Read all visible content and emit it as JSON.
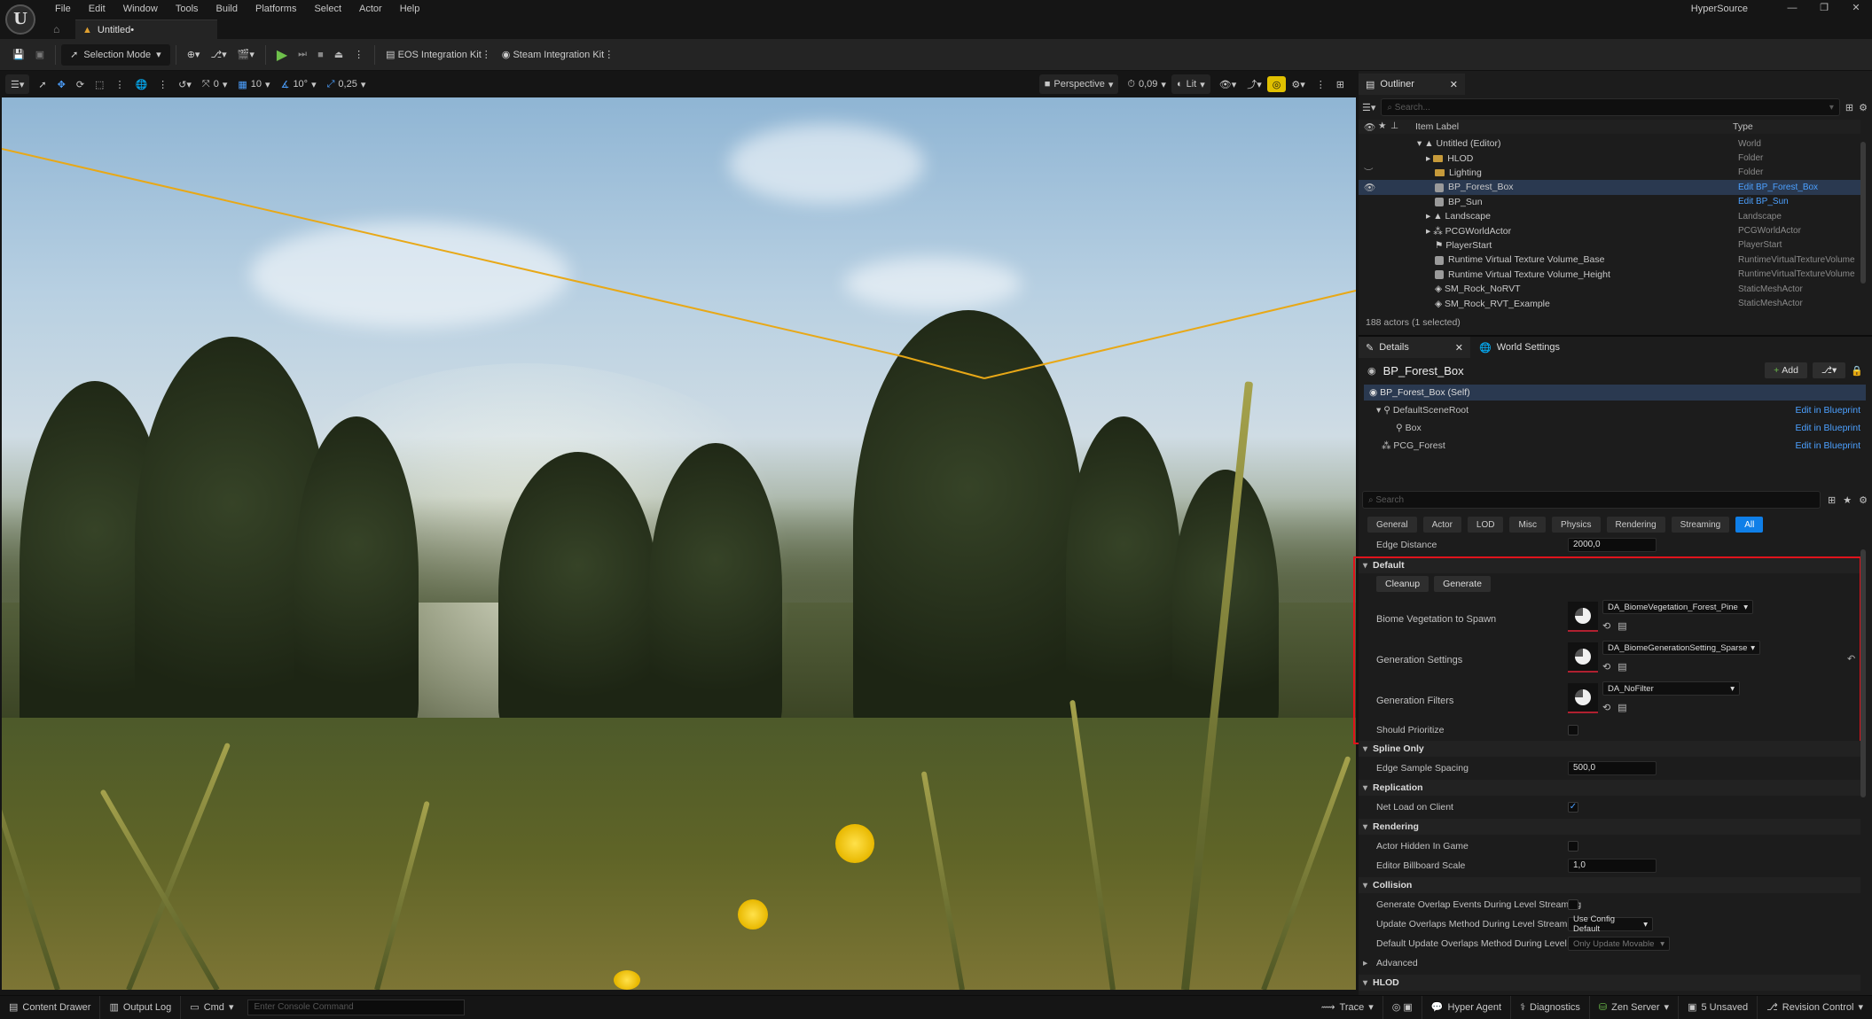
{
  "app": {
    "title": "HyperSource",
    "doc_tab": "Untitled•",
    "logo": "U"
  },
  "menu": [
    "File",
    "Edit",
    "Window",
    "Tools",
    "Build",
    "Platforms",
    "Select",
    "Actor",
    "Help"
  ],
  "toolbar": {
    "mode": "Selection Mode",
    "eos": "EOS Integration Kit",
    "steam": "Steam Integration Kit"
  },
  "viewport_toolbar": {
    "snap_rotate": "0",
    "grid": "10",
    "angle": "10°",
    "scale": "0,25",
    "view": "Perspective",
    "fov": "0,09",
    "lit": "Lit"
  },
  "outliner": {
    "tab": "Outliner",
    "search_placeholder": "Search...",
    "col_label": "Item Label",
    "col_type": "Type",
    "rows": [
      {
        "label": "Untitled (Editor)",
        "type": "World"
      },
      {
        "label": "HLOD",
        "type": "Folder"
      },
      {
        "label": "Lighting",
        "type": "Folder"
      },
      {
        "label": "BP_Forest_Box",
        "type": "Edit BP_Forest_Box"
      },
      {
        "label": "BP_Sun",
        "type": "Edit BP_Sun"
      },
      {
        "label": "Landscape",
        "type": "Landscape"
      },
      {
        "label": "PCGWorldActor",
        "type": "PCGWorldActor"
      },
      {
        "label": "PlayerStart",
        "type": "PlayerStart"
      },
      {
        "label": "Runtime Virtual Texture Volume_Base",
        "type": "RuntimeVirtualTextureVolume"
      },
      {
        "label": "Runtime Virtual Texture Volume_Height",
        "type": "RuntimeVirtualTextureVolume"
      },
      {
        "label": "SM_Rock_NoRVT",
        "type": "StaticMeshActor"
      },
      {
        "label": "SM_Rock_RVT_Example",
        "type": "StaticMeshActor"
      }
    ],
    "count": "188 actors (1 selected)"
  },
  "details": {
    "tab": "Details",
    "tab2": "World Settings",
    "actor_name": "BP_Forest_Box",
    "add_label": "Add",
    "components": [
      {
        "label": "BP_Forest_Box (Self)",
        "action": ""
      },
      {
        "label": "DefaultSceneRoot",
        "action": "Edit in Blueprint"
      },
      {
        "label": "Box",
        "action": "Edit in Blueprint"
      },
      {
        "label": "PCG_Forest",
        "action": "Edit in Blueprint"
      }
    ],
    "search_placeholder": "Search",
    "filters": [
      "General",
      "Actor",
      "LOD",
      "Misc",
      "Physics",
      "Rendering",
      "Streaming",
      "All"
    ],
    "edge_distance_label": "Edge Distance",
    "edge_distance": "2000,0",
    "section_default": "Default",
    "cleanup": "Cleanup",
    "generate": "Generate",
    "biome_label": "Biome Vegetation to Spawn",
    "biome_value": "DA_BiomeVegetation_Forest_Pine",
    "gen_settings_label": "Generation Settings",
    "gen_settings_value": "DA_BiomeGenerationSetting_Sparse",
    "gen_filters_label": "Generation Filters",
    "gen_filters_value": "DA_NoFilter",
    "should_prioritize": "Should Prioritize",
    "section_spline": "Spline Only",
    "edge_sample_label": "Edge Sample Spacing",
    "edge_sample": "500,0",
    "section_replication": "Replication",
    "net_load_label": "Net Load on Client",
    "section_rendering": "Rendering",
    "actor_hidden_label": "Actor Hidden In Game",
    "billboard_label": "Editor Billboard Scale",
    "billboard_value": "1,0",
    "section_collision": "Collision",
    "gen_overlap_label": "Generate Overlap Events During Level Streaming",
    "update_overlaps_label": "Update Overlaps Method During Level Streaming",
    "update_overlaps_value": "Use Config Default",
    "default_update_label": "Default Update Overlaps Method During Level S...",
    "default_update_value": "Only Update Movable",
    "advanced": "Advanced",
    "section_hlod": "HLOD"
  },
  "statusbar": {
    "content_drawer": "Content Drawer",
    "output_log": "Output Log",
    "cmd": "Cmd",
    "console_placeholder": "Enter Console Command",
    "trace": "Trace",
    "hyper_agent": "Hyper Agent",
    "diagnostics": "Diagnostics",
    "zen": "Zen Server",
    "unsaved": "5 Unsaved",
    "revision": "Revision Control"
  },
  "colors": {
    "accent": "#0f7fe8",
    "highlight_box": "#e0131c",
    "link": "#4ca0ff"
  }
}
